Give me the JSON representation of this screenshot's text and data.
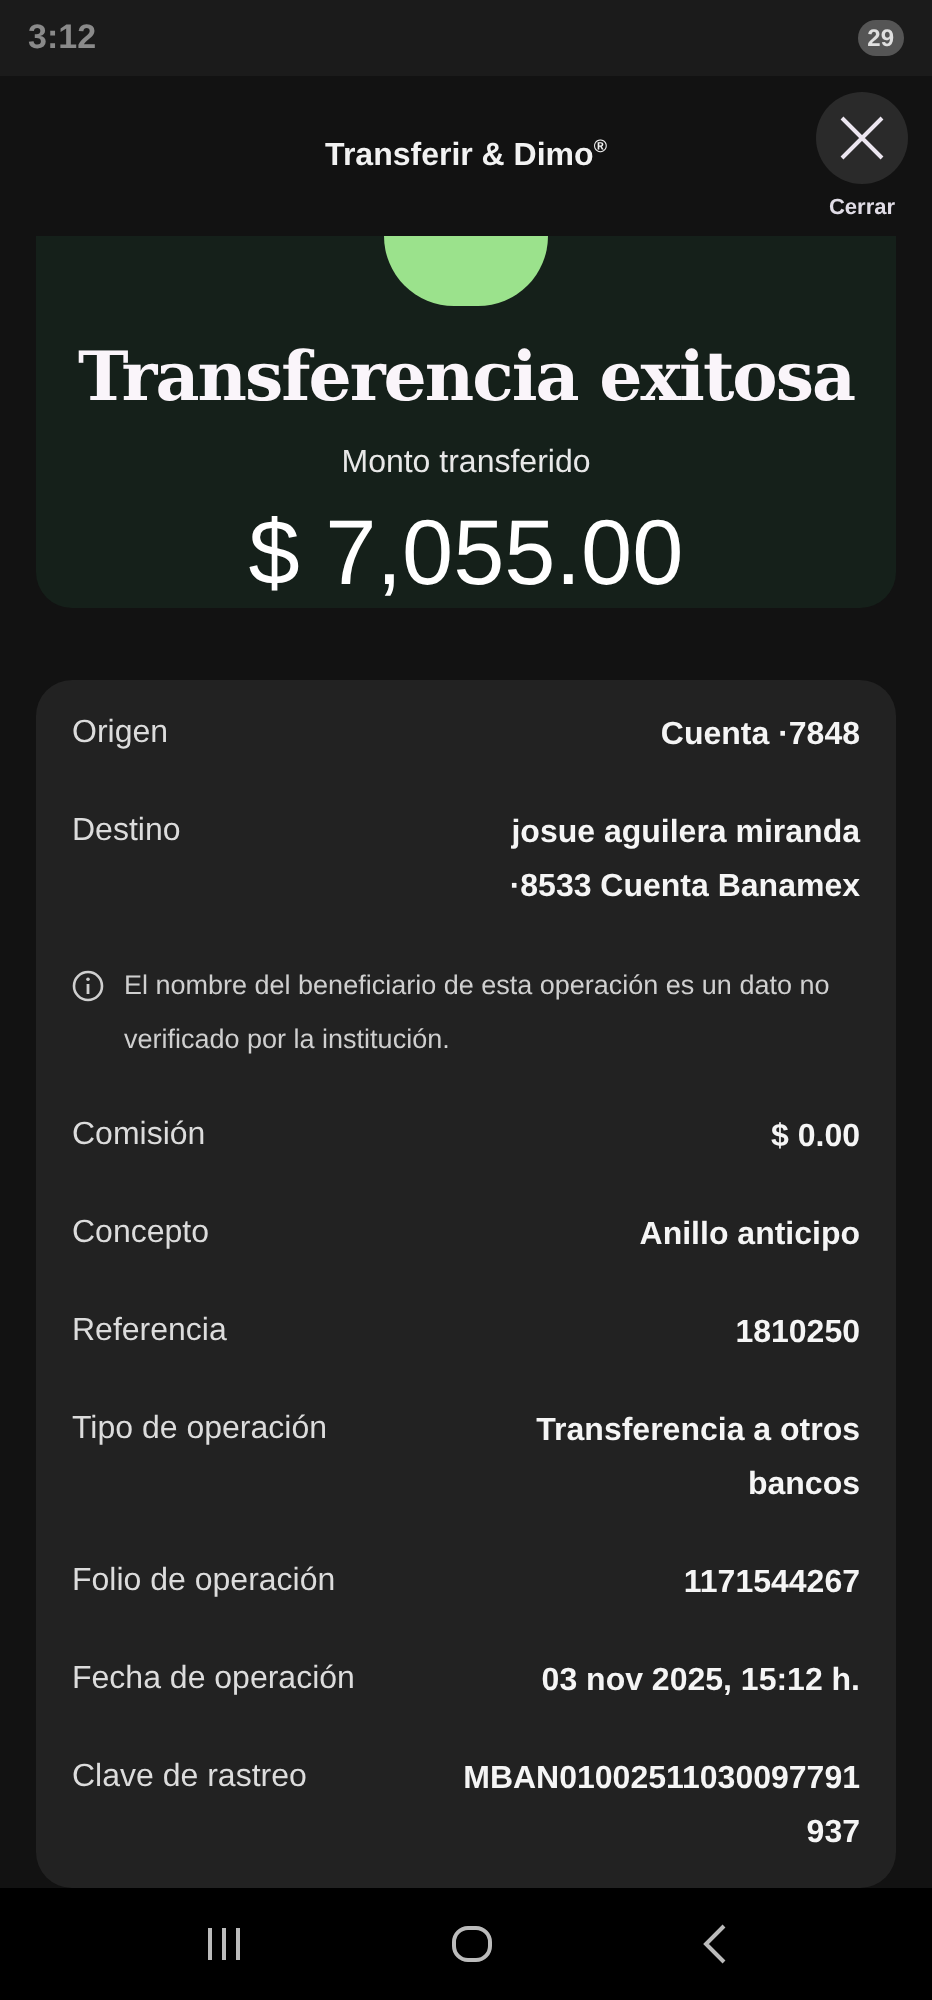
{
  "status_bar": {
    "time": "3:12",
    "battery": "29"
  },
  "header": {
    "title": "Transferir & Dimo$^{®}$",
    "close_label": "Cerrar"
  },
  "success": {
    "title": "Transferencia exitosa",
    "amount_label": "Monto transferido",
    "amount": "$ 7,055.00"
  },
  "details": [
    {
      "kind": "row",
      "label": "Origen",
      "values": [
        "Cuenta ·7848"
      ]
    },
    {
      "kind": "row",
      "label": "Destino",
      "values": [
        "josue aguilera miranda",
        "·8533 Cuenta Banamex"
      ]
    },
    {
      "kind": "notice",
      "text": "El nombre del beneficiario de esta operación es un dato no verificado por la institución."
    },
    {
      "kind": "row",
      "label": "Comisión",
      "values": [
        "$ 0.00"
      ]
    },
    {
      "kind": "row",
      "label": "Concepto",
      "values": [
        "Anillo anticipo"
      ]
    },
    {
      "kind": "row",
      "label": "Referencia",
      "values": [
        "1810250"
      ]
    },
    {
      "kind": "row",
      "label": "Tipo de operación",
      "values": [
        "Transferencia a otros bancos"
      ]
    },
    {
      "kind": "row",
      "label": "Folio de operación",
      "values": [
        "1171544267"
      ]
    },
    {
      "kind": "row",
      "label": "Fecha de operación",
      "values": [
        "03 nov 2025, 15:12 h."
      ]
    },
    {
      "kind": "row",
      "label": "Clave de rastreo",
      "values": [
        "MBAN01002511030097791937"
      ]
    }
  ]
}
